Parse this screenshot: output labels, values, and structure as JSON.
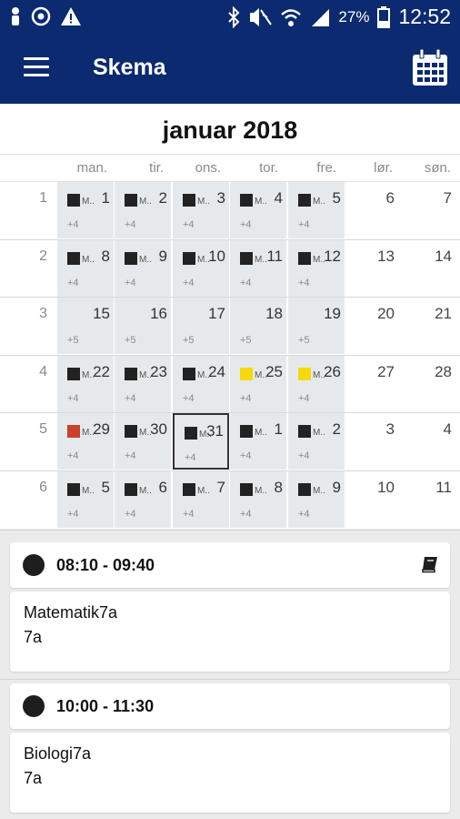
{
  "status": {
    "battery": "27%",
    "time": "12:52"
  },
  "app": {
    "title": "Skema"
  },
  "calendar": {
    "month": "januar 2018",
    "weekdays": [
      "man.",
      "tir.",
      "ons.",
      "tor.",
      "fre.",
      "lør.",
      "søn."
    ],
    "event_label": "M..",
    "weeks": [
      {
        "week": "1",
        "days": [
          {
            "n": "1",
            "ev": "dark",
            "more": "+4"
          },
          {
            "n": "2",
            "ev": "dark",
            "more": "+4"
          },
          {
            "n": "3",
            "ev": "dark",
            "more": "+4"
          },
          {
            "n": "4",
            "ev": "dark",
            "more": "+4"
          },
          {
            "n": "5",
            "ev": "dark",
            "more": "+4"
          },
          {
            "n": "6"
          },
          {
            "n": "7"
          }
        ]
      },
      {
        "week": "2",
        "days": [
          {
            "n": "8",
            "ev": "dark",
            "more": "+4"
          },
          {
            "n": "9",
            "ev": "dark",
            "more": "+4"
          },
          {
            "n": "10",
            "ev": "dark",
            "more": "+4"
          },
          {
            "n": "11",
            "ev": "dark",
            "more": "+4"
          },
          {
            "n": "12",
            "ev": "dark",
            "more": "+4"
          },
          {
            "n": "13"
          },
          {
            "n": "14"
          }
        ]
      },
      {
        "week": "3",
        "days": [
          {
            "n": "15",
            "more": "+5"
          },
          {
            "n": "16",
            "more": "+5"
          },
          {
            "n": "17",
            "more": "+5"
          },
          {
            "n": "18",
            "more": "+5"
          },
          {
            "n": "19",
            "more": "+5"
          },
          {
            "n": "20"
          },
          {
            "n": "21"
          }
        ]
      },
      {
        "week": "4",
        "days": [
          {
            "n": "22",
            "ev": "dark",
            "more": "+4"
          },
          {
            "n": "23",
            "ev": "dark",
            "more": "+4"
          },
          {
            "n": "24",
            "ev": "dark",
            "more": "+4"
          },
          {
            "n": "25",
            "ev": "yellow",
            "more": "+4"
          },
          {
            "n": "26",
            "ev": "yellow",
            "more": "+4"
          },
          {
            "n": "27"
          },
          {
            "n": "28"
          }
        ]
      },
      {
        "week": "5",
        "days": [
          {
            "n": "29",
            "ev": "red",
            "more": "+4"
          },
          {
            "n": "30",
            "ev": "dark",
            "more": "+4"
          },
          {
            "n": "31",
            "ev": "dark",
            "more": "+4",
            "selected": true
          },
          {
            "n": "1",
            "ev": "dark",
            "more": "+4"
          },
          {
            "n": "2",
            "ev": "dark",
            "more": "+4"
          },
          {
            "n": "3"
          },
          {
            "n": "4"
          }
        ]
      },
      {
        "week": "6",
        "days": [
          {
            "n": "5",
            "ev": "dark",
            "more": "+4"
          },
          {
            "n": "6",
            "ev": "dark",
            "more": "+4"
          },
          {
            "n": "7",
            "ev": "dark",
            "more": "+4"
          },
          {
            "n": "8",
            "ev": "dark",
            "more": "+4"
          },
          {
            "n": "9",
            "ev": "dark",
            "more": "+4"
          },
          {
            "n": "10"
          },
          {
            "n": "11"
          }
        ]
      }
    ]
  },
  "lessons": [
    {
      "time": "08:10 - 09:40",
      "subject": "Matematik7a",
      "class": "7a"
    },
    {
      "time": "10:00 - 11:30",
      "subject": "Biologi7a",
      "class": "7a"
    }
  ],
  "colors": {
    "primary": "#0b2a6f",
    "event_dark": "#222222",
    "event_yellow": "#f5d90a",
    "event_red": "#c8412a",
    "weekday_bg": "#e6e9eb"
  }
}
